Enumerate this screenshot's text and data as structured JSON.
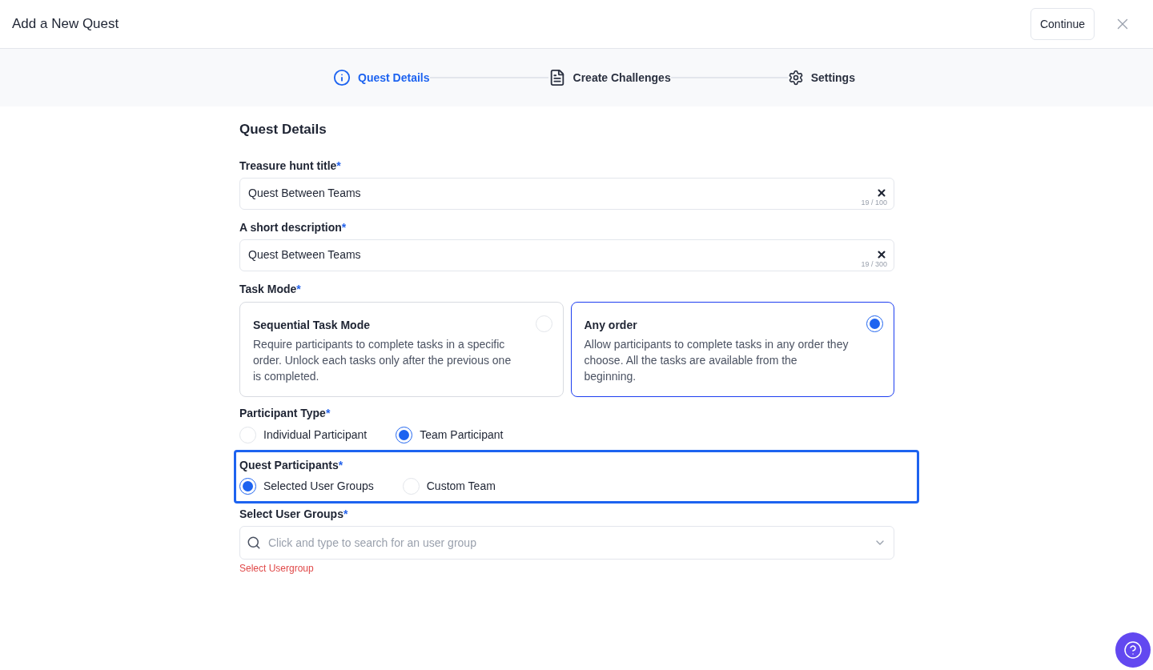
{
  "header": {
    "title": "Add a New Quest",
    "continue_button": "Continue"
  },
  "steps": [
    {
      "kind": "info",
      "label": "Quest Details",
      "selected": true
    },
    {
      "kind": "document",
      "label": "Create Challenges",
      "selected": false
    },
    {
      "kind": "settings",
      "label": "Settings",
      "selected": false
    }
  ],
  "section_title": "Quest Details",
  "fields": [
    {
      "label": "Treasure hunt title",
      "required_mark": "*",
      "value": "Quest Between Teams",
      "counter": "19 / 100"
    },
    {
      "label": "A short description",
      "required_mark": "*",
      "value": "Quest Between Teams",
      "counter": "19 / 300"
    }
  ],
  "task_mode": {
    "label": "Task Mode",
    "required_mark": "*",
    "options": [
      {
        "title": "Sequential Task Mode",
        "description": "Require participants to complete tasks in a specific order. Unlock each tasks only after the previous one is completed.",
        "selected": false
      },
      {
        "title": "Any order",
        "description": "Allow participants to complete tasks in any order they choose. All the tasks are available from the beginning.",
        "selected": true
      }
    ]
  },
  "participant_type": {
    "label": "Participant Type",
    "required_mark": "*",
    "options": [
      {
        "label": "Individual Participant",
        "selected": false
      },
      {
        "label": "Team Participant",
        "selected": true
      }
    ]
  },
  "quest_participants": {
    "label": "Quest Participants",
    "required_mark": "*",
    "focused": true,
    "options": [
      {
        "label": "Selected User Groups",
        "selected": true
      },
      {
        "label": "Custom Team",
        "selected": false
      }
    ]
  },
  "user_groups": {
    "label": "Select User Groups",
    "required_mark": "*",
    "placeholder": "Click and type to search for an user group",
    "error": "Select Usergroup"
  }
}
